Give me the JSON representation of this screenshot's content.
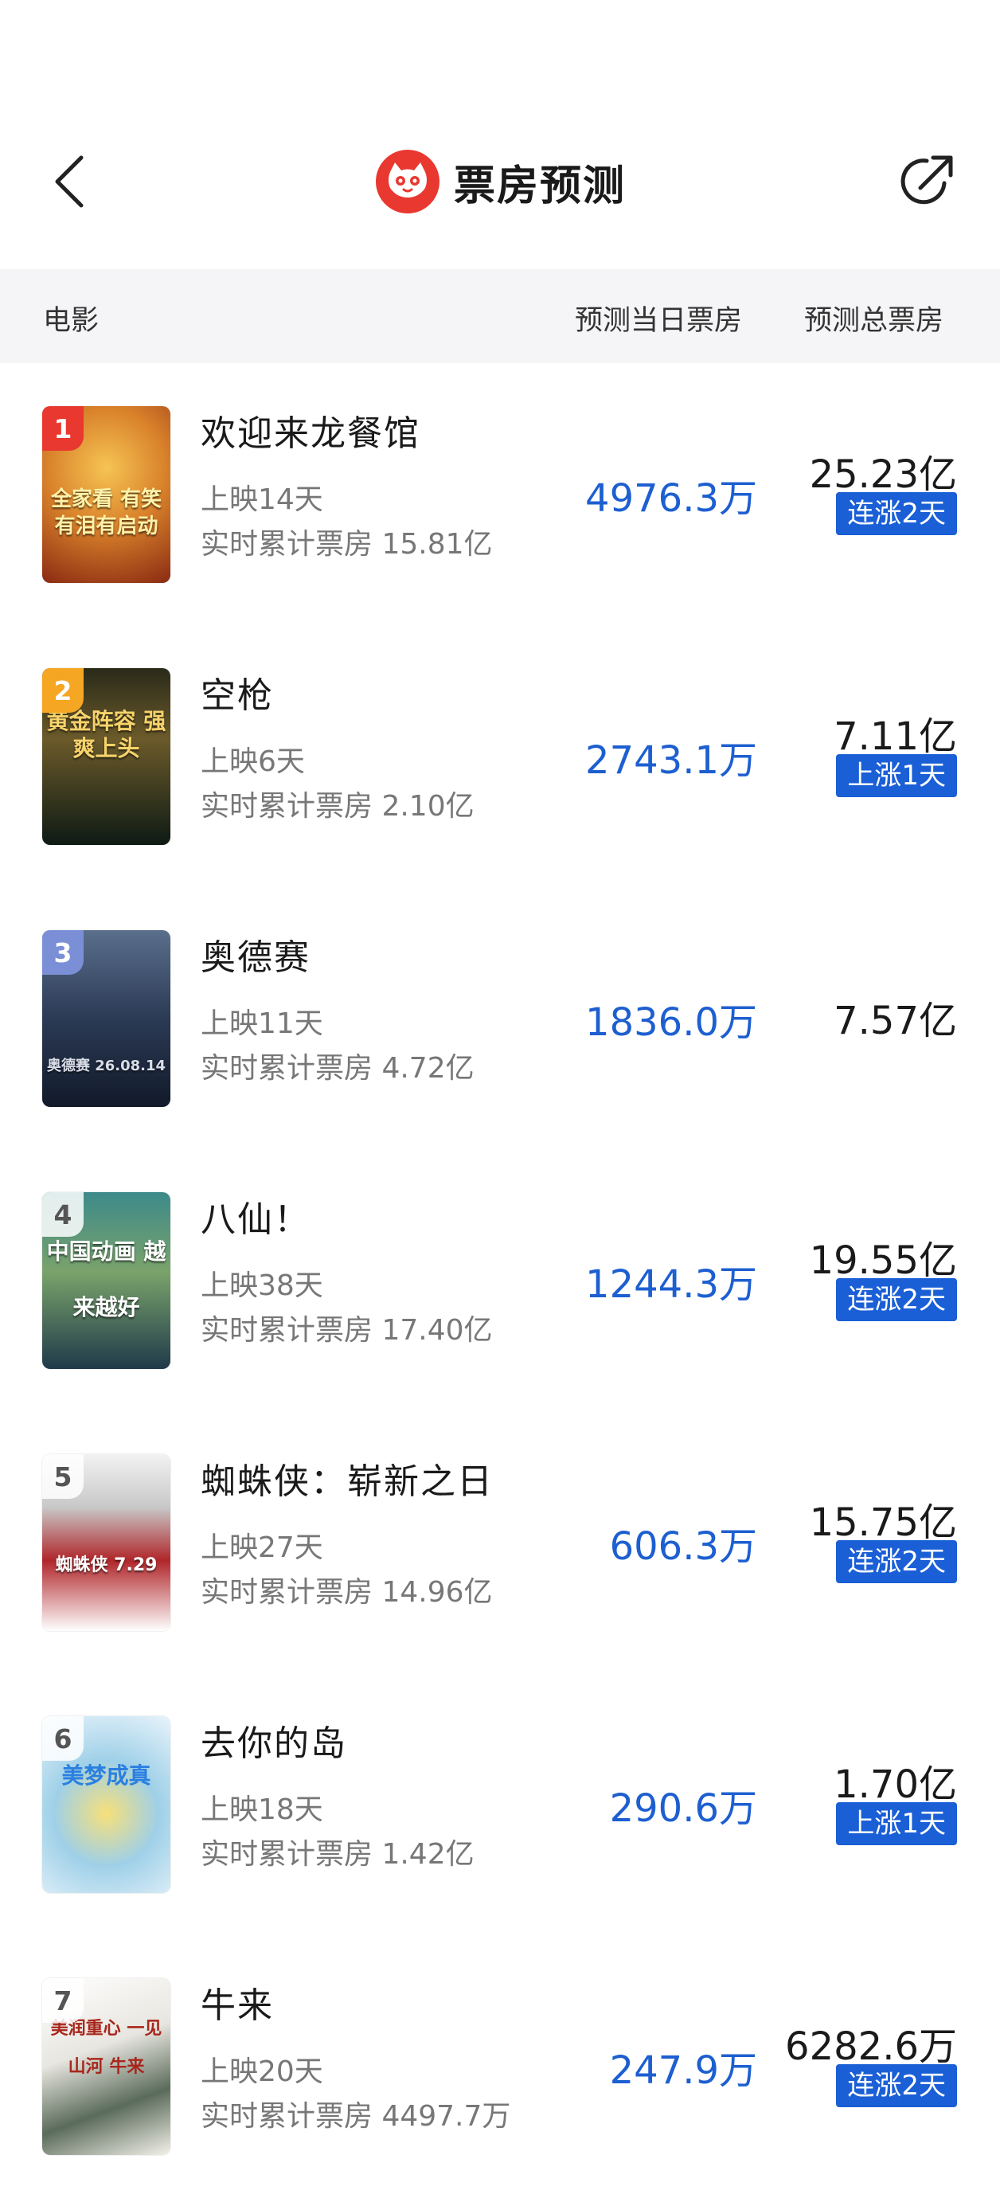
{
  "header": {
    "title": "票房预测",
    "back_icon": "chevron-left-icon",
    "share_icon": "share-arrow-icon",
    "logo_icon": "cat-logo-icon",
    "logo_color": "#e8382f"
  },
  "table_header": {
    "movie": "电影",
    "daily": "预测当日票房",
    "total": "预测总票房"
  },
  "movies": [
    {
      "rank": "1",
      "name": "欢迎来龙餐馆",
      "days": "上映14天",
      "cumulative": "实时累计票房 15.81亿",
      "daily": "4976.3万",
      "total": "25.23亿",
      "badge": "连涨2天",
      "poster_text": "全家看 有笑有泪有启动"
    },
    {
      "rank": "2",
      "name": "空枪",
      "days": "上映6天",
      "cumulative": "实时累计票房 2.10亿",
      "daily": "2743.1万",
      "total": "7.11亿",
      "badge": "上涨1天",
      "poster_text": "黄金阵容 强爽上头"
    },
    {
      "rank": "3",
      "name": "奥德赛",
      "days": "上映11天",
      "cumulative": "实时累计票房 4.72亿",
      "daily": "1836.0万",
      "total": "7.57亿",
      "badge": "",
      "poster_text": "奥德赛 26.08.14"
    },
    {
      "rank": "4",
      "name": "八仙！",
      "days": "上映38天",
      "cumulative": "实时累计票房 17.40亿",
      "daily": "1244.3万",
      "total": "19.55亿",
      "badge": "连涨2天",
      "poster_text": "中国动画 越来越好"
    },
    {
      "rank": "5",
      "name": "蜘蛛侠：崭新之日",
      "days": "上映27天",
      "cumulative": "实时累计票房 14.96亿",
      "daily": "606.3万",
      "total": "15.75亿",
      "badge": "连涨2天",
      "poster_text": "蜘蛛侠 7.29"
    },
    {
      "rank": "6",
      "name": "去你的岛",
      "days": "上映18天",
      "cumulative": "实时累计票房 1.42亿",
      "daily": "290.6万",
      "total": "1.70亿",
      "badge": "上涨1天",
      "poster_text": "美梦成真"
    },
    {
      "rank": "7",
      "name": "牛来",
      "days": "上映20天",
      "cumulative": "实时累计票房 4497.7万",
      "daily": "247.9万",
      "total": "6282.6万",
      "badge": "连涨2天",
      "poster_text": "美润重心 一见山河 牛来"
    }
  ],
  "colors": {
    "accent_blue": "#1d5fd0",
    "badge_blue": "#1a5fd6",
    "rank_red": "#e8382f",
    "rank_orange": "#f5a623",
    "rank_blue": "#7b8fd6"
  }
}
